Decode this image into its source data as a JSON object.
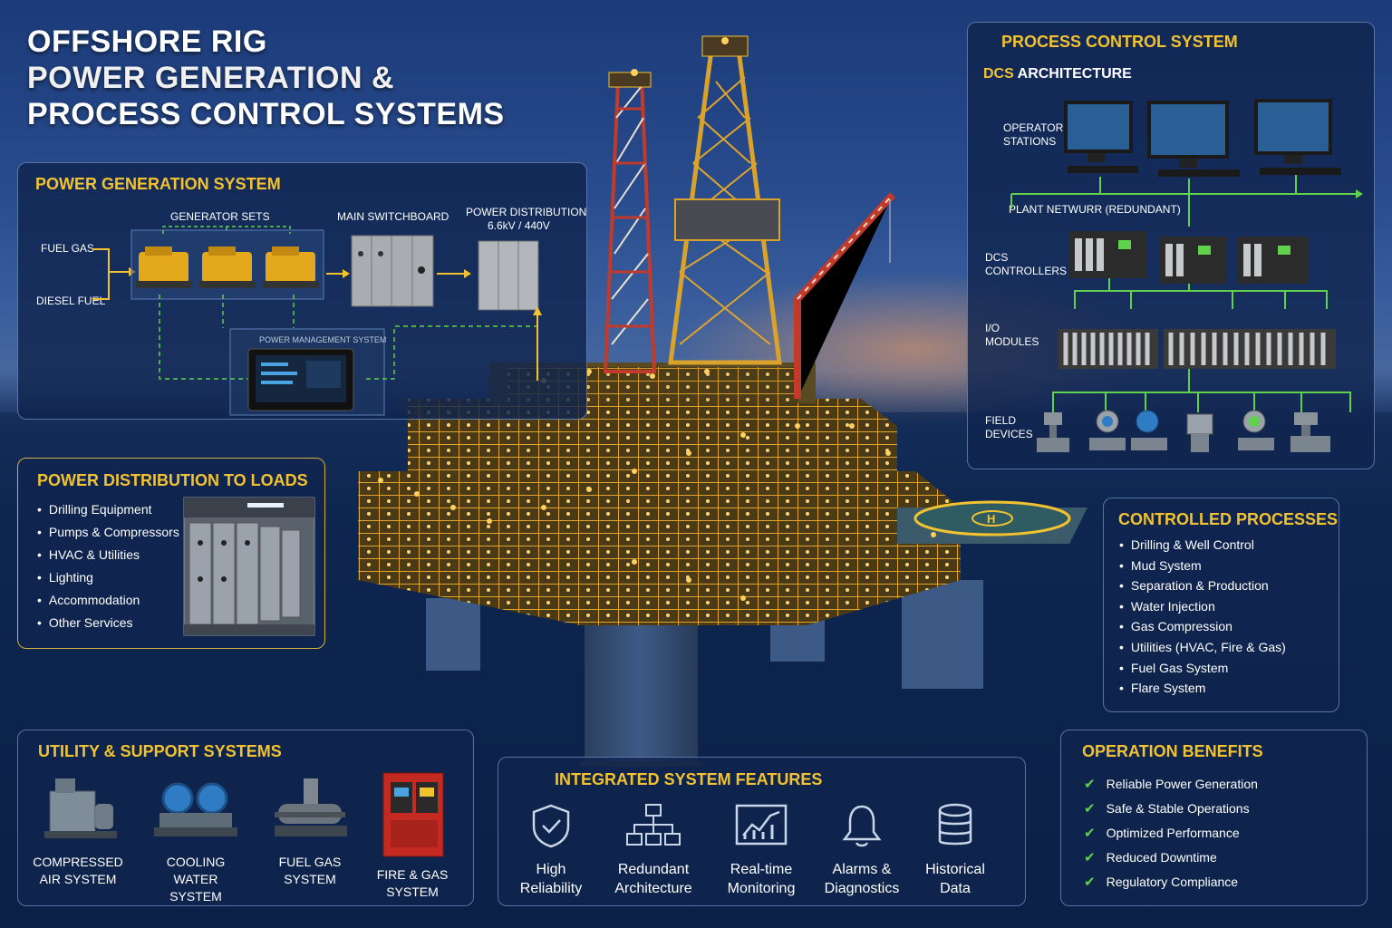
{
  "title": {
    "line1": "OFFSHORE RIG",
    "line2": "POWER GENERATION &",
    "line3": "PROCESS CONTROL SYSTEMS"
  },
  "power_generation": {
    "title": "POWER GENERATION SYSTEM",
    "fuel_gas": "FUEL GAS",
    "diesel_fuel": "DIESEL FUEL",
    "generator_sets": "GENERATOR SETS",
    "main_switchboard": "MAIN SWITCHBOARD",
    "power_distribution": "POWER DISTRIBUTION",
    "voltage": "6.6kV / 440V",
    "pms_label": "POWER MANAGEMENT SYSTEM"
  },
  "power_distribution_loads": {
    "title": "POWER DISTRIBUTION TO LOADS",
    "items": [
      "Drilling Equipment",
      "Pumps & Compressors",
      "HVAC & Utilities",
      "Lighting",
      "Accommodation",
      "Other Services"
    ]
  },
  "utility": {
    "title": "UTILITY & SUPPORT SYSTEMS",
    "items": [
      {
        "label": "COMPRESSED\nAIR SYSTEM",
        "icon": "air-compressor-icon"
      },
      {
        "label": "COOLING WATER\nSYSTEM",
        "icon": "cooling-pump-icon"
      },
      {
        "label": "FUEL GAS\nSYSTEM",
        "icon": "fuel-gas-skid-icon"
      },
      {
        "label": "FIRE & GAS\nSYSTEM",
        "icon": "fire-gas-cabinet-icon"
      }
    ]
  },
  "features": {
    "title": "INTEGRATED SYSTEM FEATURES",
    "items": [
      {
        "label": "High\nReliability",
        "icon": "shield-check-icon"
      },
      {
        "label": "Redundant\nArchitecture",
        "icon": "hierarchy-icon"
      },
      {
        "label": "Real-time\nMonitoring",
        "icon": "monitor-chart-icon"
      },
      {
        "label": "Alarms &\nDiagnostics",
        "icon": "bell-icon"
      },
      {
        "label": "Historical\nData",
        "icon": "database-icon"
      }
    ]
  },
  "process_control": {
    "title": "PROCESS CONTROL SYSTEM",
    "subtitle_accent": "DCS",
    "subtitle_rest": " ARCHITECTURE",
    "operator_stations": "OPERATOR\nSTATIONS",
    "plant_network": "PLANT NETWURR (REDUNDANT)",
    "dcs_controllers": "DCS\nCONTROLLERS",
    "io_modules": "I/O\nMODULES",
    "field_devices": "FIELD\nDEVICES"
  },
  "controlled_processes": {
    "title": "CONTROLLED PROCESSES",
    "items": [
      "Drilling & Well Control",
      "Mud System",
      "Separation & Production",
      "Water Injection",
      "Gas Compression",
      "Utilities (HVAC, Fire & Gas)",
      "Fuel Gas System",
      "Flare System"
    ]
  },
  "operation_benefits": {
    "title": "OPERATION BENEFITS",
    "items": [
      "Reliable Power Generation",
      "Safe & Stable Operations",
      "Optimized Performance",
      "Reduced Downtime",
      "Regulatory Compliance"
    ]
  },
  "colors": {
    "accent_gold": "#f2c230",
    "network_green": "#5fd14a",
    "panel_bg": "#10244e"
  }
}
